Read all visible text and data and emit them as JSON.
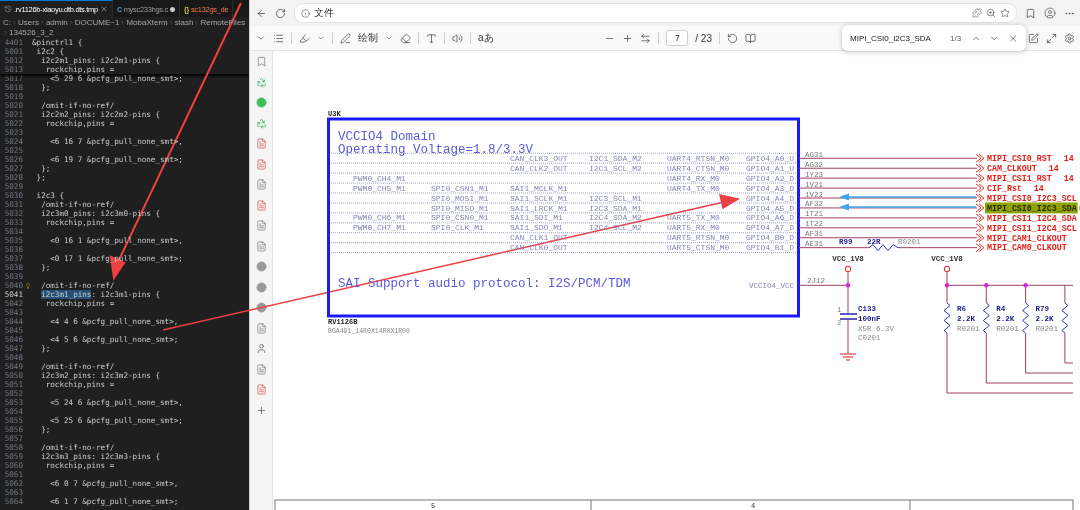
{
  "editor": {
    "tabs": [
      {
        "label": ".rv1126b-xiaoyu.dtb.dts.tmp",
        "kind": "tmp",
        "selected": true,
        "modified": false,
        "problems": false
      },
      {
        "label": "mysc233hgs.c",
        "kind": "c",
        "icon_text": "C",
        "selected": false,
        "modified": true,
        "problems": false
      },
      {
        "label": "sc132gs_de",
        "kind": "json",
        "icon_text": "{}",
        "selected": false,
        "modified": false,
        "problems": true
      }
    ],
    "breadcrumb": [
      "C:",
      "Users",
      "admin",
      "DOCUME~1",
      "MobaXterm",
      "slash",
      "RemoteFiles",
      "134526_3_2"
    ],
    "sticky_lines": [
      {
        "no": "4401",
        "code": "&pinctrl1 {"
      },
      {
        "no": "5001",
        "code": " i2c2 {"
      },
      {
        "no": "5012",
        "code": "  i2c2m1_pins: i2c2m1-pins {"
      },
      {
        "no": "5013",
        "code": "   rockchip,pins ="
      }
    ],
    "lines": [
      {
        "no": "5017",
        "code": "    <5 29 6 &pcfg_pull_none_smt>;",
        "current": false,
        "hint": false
      },
      {
        "no": "5018",
        "code": "  };",
        "current": false,
        "hint": false
      },
      {
        "no": "5019",
        "current": false,
        "hint": false
      },
      {
        "no": "5020",
        "code": "  /omit-if-no-ref/",
        "current": false,
        "hint": false
      },
      {
        "no": "5021",
        "code": "  i2c2m2_pins: i2c2m2-pins {",
        "current": false,
        "hint": false
      },
      {
        "no": "5022",
        "code": "   rockchip,pins =",
        "current": false,
        "hint": false
      },
      {
        "no": "5023",
        "current": false,
        "hint": false
      },
      {
        "no": "5024",
        "code": "    <6 16 7 &pcfg_pull_none_smt>,",
        "current": false,
        "hint": false
      },
      {
        "no": "5025",
        "current": false,
        "hint": false
      },
      {
        "no": "5026",
        "code": "    <6 19 7 &pcfg_pull_none_smt>;",
        "current": false,
        "hint": false
      },
      {
        "no": "5027",
        "code": "  };",
        "current": false,
        "hint": false
      },
      {
        "no": "5028",
        "code": " };",
        "current": false,
        "hint": false
      },
      {
        "no": "5029",
        "current": false,
        "hint": false
      },
      {
        "no": "5030",
        "code": " i2c3 {",
        "current": false,
        "hint": false
      },
      {
        "no": "5031",
        "code": "  /omit-if-no-ref/",
        "current": false,
        "hint": false
      },
      {
        "no": "5032",
        "code": "  i2c3m0_pins: i2c3m0-pins {",
        "current": false,
        "hint": false
      },
      {
        "no": "5033",
        "code": "   rockchip,pins =",
        "current": false,
        "hint": false
      },
      {
        "no": "5034",
        "current": false,
        "hint": false
      },
      {
        "no": "5035",
        "code": "    <0 16 1 &pcfg_pull_none_smt>,",
        "current": false,
        "hint": false
      },
      {
        "no": "5036",
        "current": false,
        "hint": false
      },
      {
        "no": "5037",
        "code": "    <0 17 1 &pcfg_pull_none_smt>;",
        "current": false,
        "hint": false
      },
      {
        "no": "5038",
        "code": "  };",
        "current": false,
        "hint": false
      },
      {
        "no": "5039",
        "current": false,
        "hint": false
      },
      {
        "no": "5040",
        "code": "  /omit-if-no-ref/",
        "current": false,
        "hint": true
      },
      {
        "no": "5041",
        "segments": [
          {
            "text": "  i2c3m1_pins",
            "highlighted": true
          },
          {
            "text": ": i2c3m1-pins {",
            "highlighted": false
          }
        ],
        "current": true,
        "hint": false
      },
      {
        "no": "5042",
        "code": "   rockchip,pins =",
        "current": false,
        "hint": false
      },
      {
        "no": "5043",
        "current": false,
        "hint": false
      },
      {
        "no": "5044",
        "code": "    <4 4 6 &pcfg_pull_none_smt>,",
        "current": false,
        "hint": false
      },
      {
        "no": "5045",
        "current": false,
        "hint": false
      },
      {
        "no": "5046",
        "code": "    <4 5 6 &pcfg_pull_none_smt>;",
        "current": false,
        "hint": false
      },
      {
        "no": "5047",
        "code": "  };",
        "current": false,
        "hint": false
      },
      {
        "no": "5048",
        "current": false,
        "hint": false
      },
      {
        "no": "5049",
        "code": "  /omit-if-no-ref/",
        "current": false,
        "hint": false
      },
      {
        "no": "5050",
        "code": "  i2c3m2_pins: i2c3m2-pins {",
        "current": false,
        "hint": false
      },
      {
        "no": "5051",
        "code": "   rockchip,pins =",
        "current": false,
        "hint": false
      },
      {
        "no": "5052",
        "current": false,
        "hint": false
      },
      {
        "no": "5053",
        "code": "    <5 24 6 &pcfg_pull_none_smt>,",
        "current": false,
        "hint": false
      },
      {
        "no": "5054",
        "current": false,
        "hint": false
      },
      {
        "no": "5055",
        "code": "    <5 25 6 &pcfg_pull_none_smt>;",
        "current": false,
        "hint": false
      },
      {
        "no": "5056",
        "code": "  };",
        "current": false,
        "hint": false
      },
      {
        "no": "5057",
        "current": false,
        "hint": false
      },
      {
        "no": "5058",
        "code": "  /omit-if-no-ref/",
        "current": false,
        "hint": false
      },
      {
        "no": "5059",
        "code": "  i2c3m3_pins: i2c3m3-pins {",
        "current": false,
        "hint": false
      },
      {
        "no": "5060",
        "code": "   rockchip,pins =",
        "current": false,
        "hint": false
      },
      {
        "no": "5061",
        "current": false,
        "hint": false
      },
      {
        "no": "5062",
        "code": "    <6 0 7 &pcfg_pull_none_smt>,",
        "current": false,
        "hint": false
      },
      {
        "no": "5063",
        "current": false,
        "hint": false
      },
      {
        "no": "5064",
        "code": "    <6 1 7 &pcfg_pull_none_smt>;",
        "current": false,
        "hint": false
      }
    ]
  },
  "browser": {
    "address": "文件",
    "pdf_toolbar": {
      "draw_label": "绘制",
      "translate_label": "aあ",
      "page": "7",
      "page_total": "/ 23"
    },
    "find": {
      "query": "MIPI_CSI0_I2C3_SDA",
      "count": "1/3"
    }
  },
  "schematic": {
    "part": {
      "ref": "U3K",
      "name": "RV1126B",
      "package": "BGA491_14R0X14R0X1R00",
      "title_lines": [
        "VCCIO4 Domain",
        "Operating Voltage=1.8/3.3V"
      ],
      "note": "SAI Support audio protocol: I2S/PCM/TDM",
      "power_pin": {
        "name": "VCCIO4_VCC",
        "number": "2J12"
      }
    },
    "pin_rows": [
      {
        "f3": "CAN_CLK3_OUT",
        "f4": "I2C1_SDA_M2",
        "f5": "UART4_RTSN_M0",
        "gpio": "GPIO4_A0_U",
        "pin": "AG31",
        "net": "MIPI_CSI0_RST",
        "sheet": "14",
        "highlighted": false,
        "annotated": false
      },
      {
        "f3": "CAN_CLK2_OUT",
        "f4": "I2C1_SCL_M2",
        "f5": "UART4_CTSN_M0",
        "gpio": "GPIO4_A1_U",
        "pin": "AG32",
        "net": "CAM_CLKOUT",
        "sheet": "14",
        "highlighted": false,
        "annotated": false
      },
      {
        "f1": "PWM0_CH4_M1",
        "f5": "UART4_RX_M0",
        "gpio": "GPIO4_A2_D",
        "pin": "1Y23",
        "net": "MIPI_CSI1_RST",
        "sheet": "14",
        "highlighted": false,
        "annotated": false
      },
      {
        "f1": "PWM0_CH5_M1",
        "f2": "SPI0_CSN1_M1",
        "f3": "SAI1_MCLK_M1",
        "f5": "UART4_TX_M0",
        "gpio": "GPIO4_A3_D",
        "pin": "1V21",
        "net": "CIF_Rst",
        "sheet": "14",
        "highlighted": false,
        "annotated": false
      },
      {
        "f2": "SPI0_MOSI_M1",
        "f3": "SAI1_SCLK_M1",
        "f4": "I2C3_SCL_M1",
        "gpio": "GPIO4_A4_D",
        "pin": "1V22",
        "net": "MIPI_CSI0_I2C3_SCL",
        "highlighted": false,
        "annotated": true
      },
      {
        "f2": "SPI0_MISO_M1",
        "f3": "SAI1_LRCK_M1",
        "f4": "I2C3_SDA_M1",
        "gpio": "GPIO4_A5_D",
        "pin": "AF32",
        "net": "MIPI_CSI0_I2C3_SDA",
        "highlighted": true,
        "annotated": true
      },
      {
        "f1": "PWM0_CH6_M1",
        "f2": "SPI0_CSN0_M1",
        "f3": "SAI1_SDI_M1",
        "f4": "I2C4_SDA_M2",
        "f5": "UART5_TX_M0",
        "gpio": "GPIO4_A6_D",
        "pin": "1T21",
        "net": "MIPI_CSI1_I2C4_SDA",
        "highlighted": false,
        "annotated": false
      },
      {
        "f1": "PWM0_CH7_M1",
        "f2": "SPI0_CLK_M1",
        "f3": "SAI1_SDO_M1",
        "f4": "I2C4_SCL_M2",
        "f5": "UART5_RX_M0",
        "gpio": "GPIO4_A7_D",
        "pin": "1T22",
        "net": "MIPI_CSI1_I2C4_SCL",
        "highlighted": false,
        "annotated": false
      },
      {
        "f3": "CAN_CLK1_OUT",
        "f5": "UART5_RTSN_M0",
        "gpio": "GPIO4_B0_D",
        "pin": "AF31",
        "net": "MIPI_CAM1_CLKOUT",
        "highlighted": false,
        "annotated": false
      },
      {
        "f3": "CAN_CLK0_OUT",
        "f5": "UART5_CTSN_M0",
        "gpio": "GPIO4_B1_D",
        "pin": "AE31",
        "net": "MIPI_CAM0_CLKOUT",
        "highlighted": false,
        "annotated": false,
        "series_resistor": {
          "ref": "R99",
          "value": "22R",
          "package": "R0201"
        }
      }
    ],
    "power_labels": [
      "VCC_1V8",
      "VCC_1V8"
    ],
    "capacitor": {
      "ref": "C133",
      "value": "100nF",
      "rating": "X5R 6.3V",
      "package": "C0201",
      "pins": [
        "1",
        "2"
      ]
    },
    "resistors": [
      {
        "ref": "R6",
        "value": "2.2K",
        "package": "R0201"
      },
      {
        "ref": "R4",
        "value": "2.2K",
        "package": "R0201"
      },
      {
        "ref": "R79",
        "value": "2.2K",
        "package": "R0201"
      }
    ],
    "zones": [
      "5",
      "4"
    ]
  }
}
